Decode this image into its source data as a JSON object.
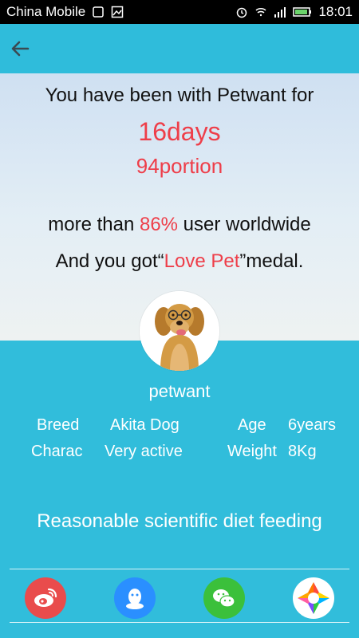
{
  "status": {
    "carrier": "China Mobile",
    "time": "18:01"
  },
  "appbar": {
    "back_icon": "arrow-left-icon"
  },
  "hero": {
    "line1": "You have been with Petwant for",
    "days_value": "16",
    "days_unit": "days",
    "portion_value": "94",
    "portion_unit": "portion",
    "compare_prefix": "more than ",
    "compare_percent": "86%",
    "compare_suffix": " user worldwide",
    "medal_prefix": "And you got“",
    "medal_name": "Love Pet",
    "medal_suffix": "”medal."
  },
  "pet": {
    "name": "petwant",
    "breed_label": "Breed",
    "breed_value": "Akita Dog",
    "age_label": "Age",
    "age_value": "6years",
    "charac_label": "Charac",
    "charac_value": "Very active",
    "weight_label": "Weight",
    "weight_value": "8Kg"
  },
  "note": "Reasonable scientific diet feeding",
  "share": [
    {
      "name": "weibo",
      "icon": "weibo-icon",
      "color": "#e94c4c"
    },
    {
      "name": "qq",
      "icon": "qq-icon",
      "color": "#2a8fff"
    },
    {
      "name": "wechat",
      "icon": "wechat-icon",
      "color": "#3bc03b"
    },
    {
      "name": "moments",
      "icon": "moments-icon",
      "color": "#ffffff"
    }
  ]
}
